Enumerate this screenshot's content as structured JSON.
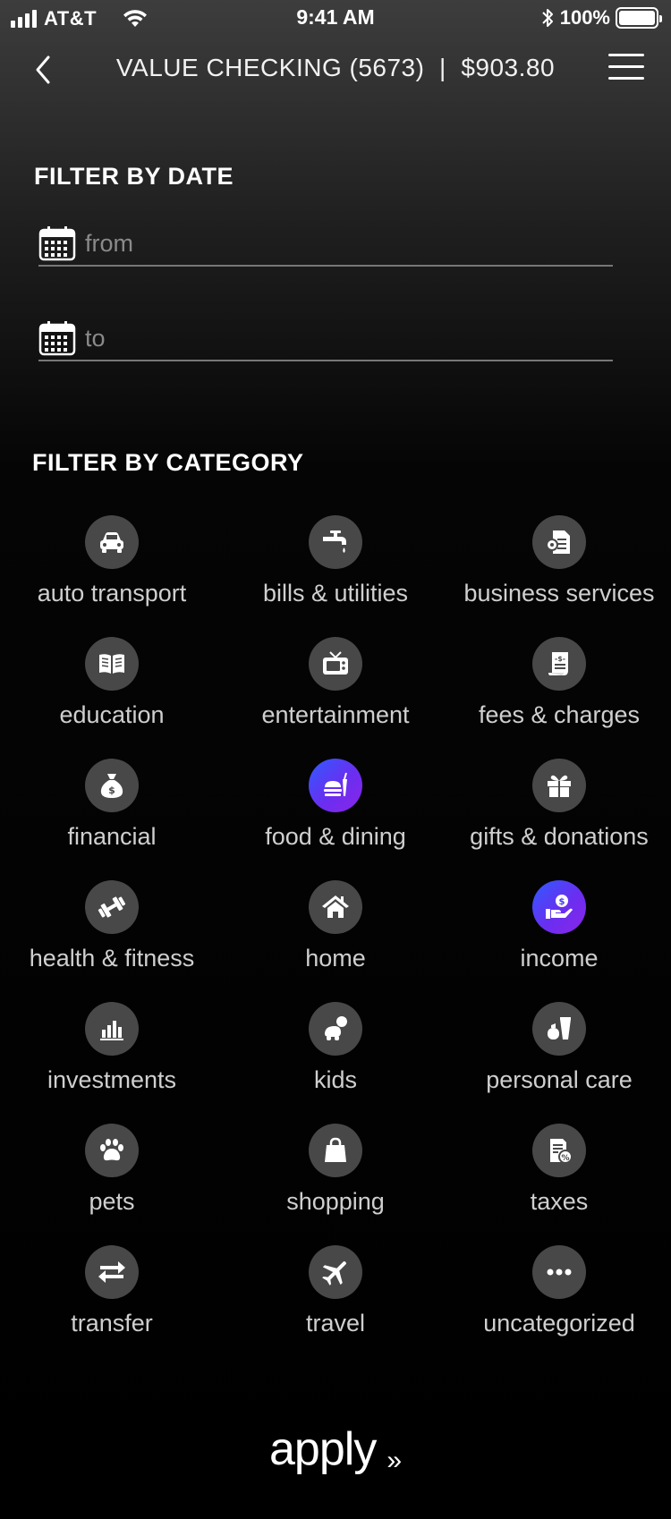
{
  "status_bar": {
    "carrier": "AT&T",
    "time": "9:41 AM",
    "battery": "100%"
  },
  "nav": {
    "title": "VALUE CHECKING (5673)  |  $903.80"
  },
  "date_filter": {
    "title": "FILTER BY DATE",
    "from_placeholder": "from",
    "to_placeholder": "to"
  },
  "category_filter": {
    "title": "FILTER BY CATEGORY",
    "items": [
      {
        "label": "auto transport",
        "icon": "car-icon",
        "selected": false
      },
      {
        "label": "bills & utilities",
        "icon": "faucet-icon",
        "selected": false
      },
      {
        "label": "business services",
        "icon": "business-document-icon",
        "selected": false
      },
      {
        "label": "education",
        "icon": "book-icon",
        "selected": false
      },
      {
        "label": "entertainment",
        "icon": "tv-icon",
        "selected": false
      },
      {
        "label": "fees & charges",
        "icon": "receipt-icon",
        "selected": false
      },
      {
        "label": "financial",
        "icon": "money-bag-icon",
        "selected": false
      },
      {
        "label": "food & dining",
        "icon": "food-icon",
        "selected": true
      },
      {
        "label": "gifts & donations",
        "icon": "gift-icon",
        "selected": false
      },
      {
        "label": "health & fitness",
        "icon": "dumbbell-icon",
        "selected": false
      },
      {
        "label": "home",
        "icon": "house-icon",
        "selected": false
      },
      {
        "label": "income",
        "icon": "hand-coin-icon",
        "selected": true
      },
      {
        "label": "investments",
        "icon": "bar-chart-icon",
        "selected": false
      },
      {
        "label": "kids",
        "icon": "baby-icon",
        "selected": false
      },
      {
        "label": "personal care",
        "icon": "personal-care-icon",
        "selected": false
      },
      {
        "label": "pets",
        "icon": "paw-icon",
        "selected": false
      },
      {
        "label": "shopping",
        "icon": "shopping-bag-icon",
        "selected": false
      },
      {
        "label": "taxes",
        "icon": "tax-document-icon",
        "selected": false
      },
      {
        "label": "transfer",
        "icon": "transfer-arrows-icon",
        "selected": false
      },
      {
        "label": "travel",
        "icon": "airplane-icon",
        "selected": false
      },
      {
        "label": "uncategorized",
        "icon": "more-dots-icon",
        "selected": false
      }
    ]
  },
  "apply": {
    "label": "apply",
    "chevron": "»"
  },
  "colors": {
    "accent_start": "#2f5bff",
    "accent_end": "#8b25e8",
    "icon_bg": "#484848",
    "label": "#cfcfcf"
  }
}
